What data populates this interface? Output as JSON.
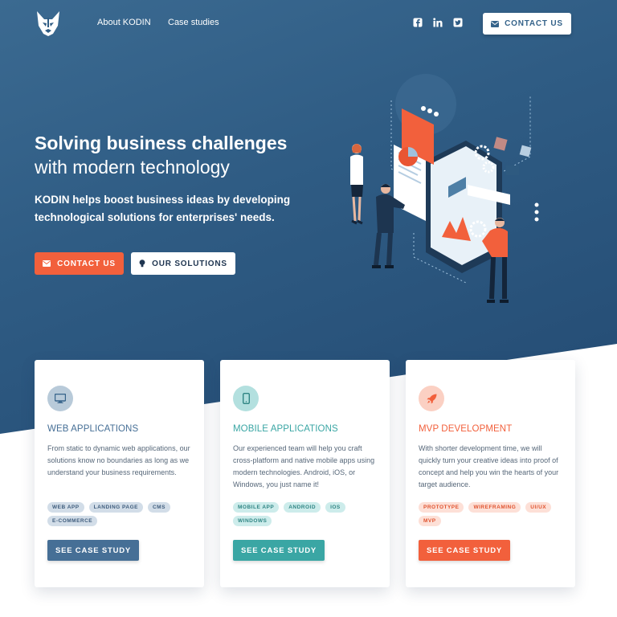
{
  "nav": {
    "links": [
      "About KODIN",
      "Case studies"
    ],
    "social_icons": [
      "facebook-icon",
      "linkedin-icon",
      "twitter-icon"
    ],
    "contact_label": "CONTACT US"
  },
  "hero": {
    "title_bold": "Solving business challenges",
    "title_light": "with modern technology",
    "lead": "KODIN helps boost business ideas by developing technological solutions for enterprises' needs.",
    "contact_label": "CONTACT US",
    "solutions_label": "OUR SOLUTIONS"
  },
  "cards": [
    {
      "icon": "monitor-icon",
      "title": "WEB APPLICATIONS",
      "description": "From static to dynamic web applications, our solutions know no boundaries as long as we understand your business requirements.",
      "tags": [
        "WEB APP",
        "LANDING PAGE",
        "CMS",
        "E-COMMERCE"
      ],
      "button": "SEE CASE STUDY",
      "accent": "#466f96",
      "icon_bg": "#b8cad9",
      "tag_bg": "#d2dde8",
      "tag_color": "#3f5d7d"
    },
    {
      "icon": "smartphone-icon",
      "title": "MOBILE APPLICATIONS",
      "description": "Our experienced team will help you craft cross-platform and native mobile apps using modern technologies. Android, iOS, or Windows, you just name it!",
      "tags": [
        "MOBILE APP",
        "ANDROID",
        "IOS",
        "WINDOWS"
      ],
      "button": "SEE CASE STUDY",
      "accent": "#3aa6a4",
      "icon_bg": "#b3e0df",
      "tag_bg": "#cdeceb",
      "tag_color": "#2f8584"
    },
    {
      "icon": "rocket-icon",
      "title": "MVP DEVELOPMENT",
      "description": "With shorter development time, we will quickly turn your creative ideas into proof of concept and help you win the hearts of your target audience.",
      "tags": [
        "PROTOTYPE",
        "WIREFRAMING",
        "UI/UX",
        "MVP"
      ],
      "button": "SEE CASE STUDY",
      "accent": "#f2603c",
      "icon_bg": "#fbd0c3",
      "tag_bg": "#fde0d7",
      "tag_color": "#e0532f"
    }
  ]
}
